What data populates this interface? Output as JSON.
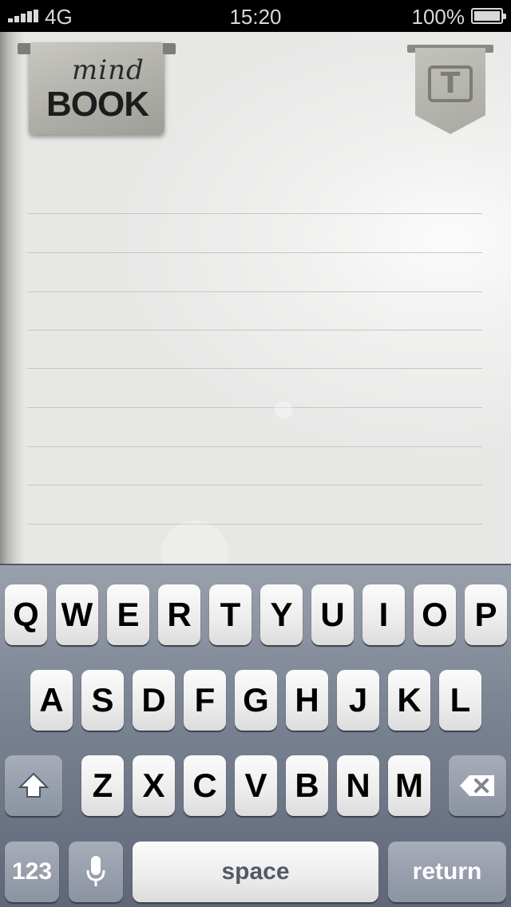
{
  "status_bar": {
    "carrier": "4G",
    "time": "15:20",
    "battery_percent": "100%"
  },
  "app": {
    "logo_line1": "mind",
    "logo_line2": "BOOK",
    "text_tag_glyph": "T",
    "icons": [
      "signal-icon",
      "battery-icon",
      "text-format-icon"
    ]
  },
  "keyboard": {
    "row1": [
      "Q",
      "W",
      "E",
      "R",
      "T",
      "Y",
      "U",
      "I",
      "O",
      "P"
    ],
    "row2": [
      "A",
      "S",
      "D",
      "F",
      "G",
      "H",
      "J",
      "K",
      "L"
    ],
    "row3": [
      "Z",
      "X",
      "C",
      "V",
      "B",
      "N",
      "M"
    ],
    "numbers_key": "123",
    "space_key": "space",
    "return_key": "return",
    "icons": [
      "shift-icon",
      "backspace-icon",
      "microphone-icon"
    ]
  },
  "colors": {
    "paper": "#ececeb",
    "keyboard_top": "#9aa1ad",
    "keyboard_bottom": "#5f6778",
    "key_face": "#f4f4f4",
    "function_key": "#8c93a1"
  }
}
